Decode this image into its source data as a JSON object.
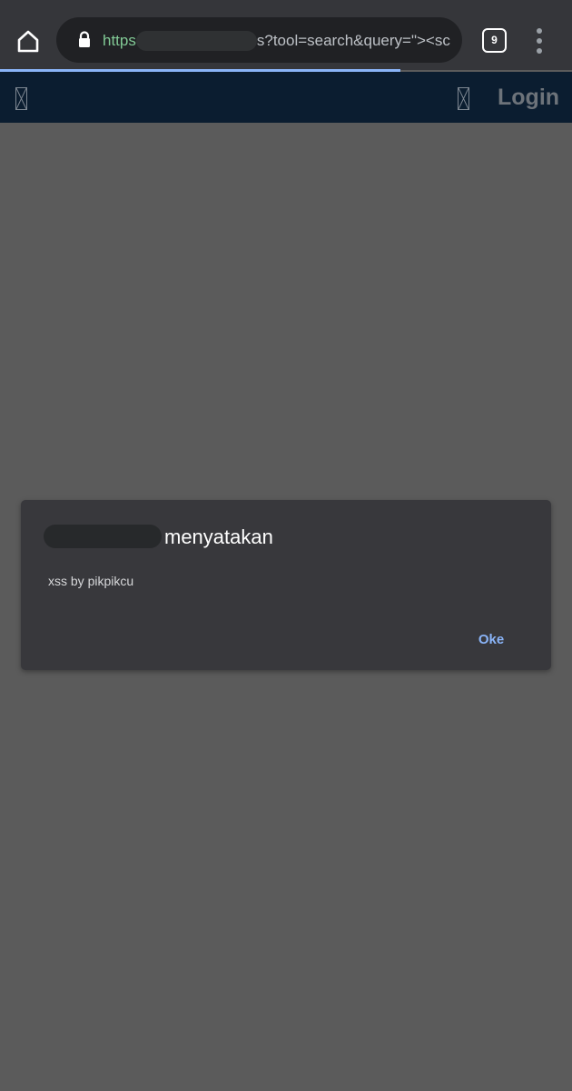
{
  "browser": {
    "url": {
      "scheme": "https",
      "rest": "s?tool=search&query=\"><scr"
    },
    "tab_count": "9",
    "accent_color": "#8ab4f8"
  },
  "site_header": {
    "login_label": "Login"
  },
  "dialog": {
    "title_suffix": "menyatakan",
    "message": "xss by pikpikcu",
    "ok_label": "Oke"
  }
}
